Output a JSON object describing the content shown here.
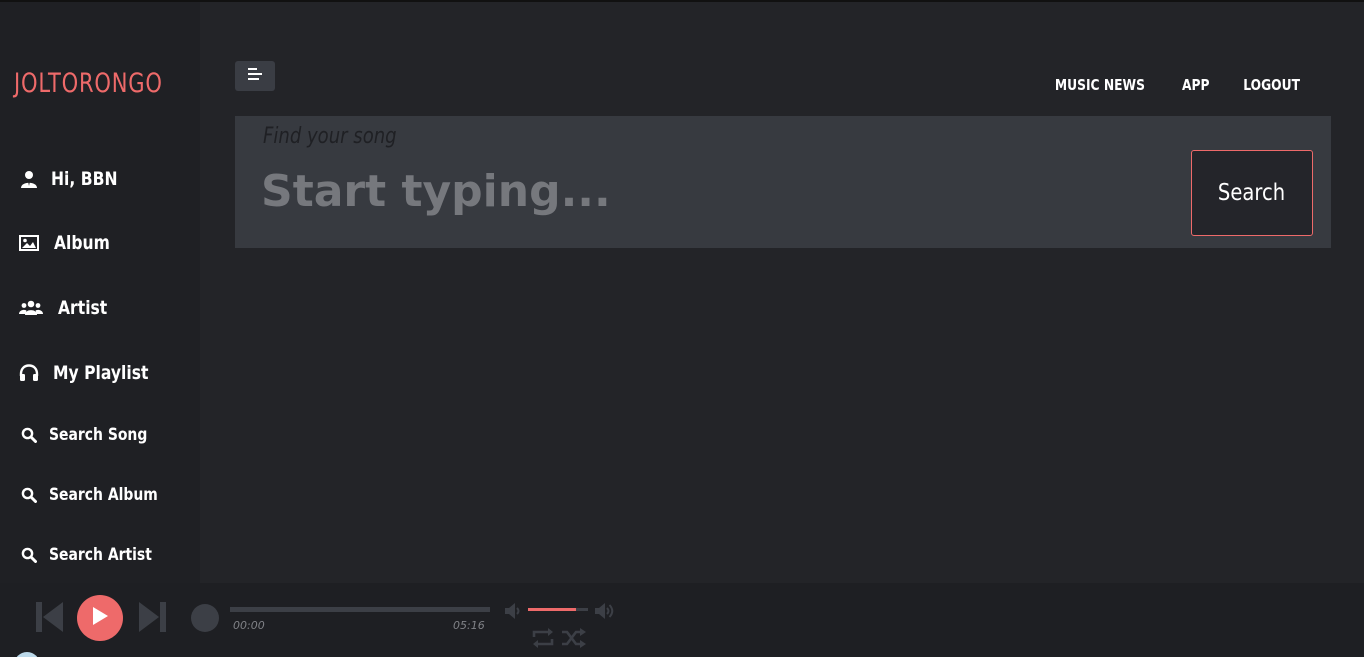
{
  "brand": "JOLTORONGO",
  "sidebar": {
    "items": [
      {
        "label": "Hi, BBN",
        "icon": "user-icon"
      },
      {
        "label": "Album",
        "icon": "image-icon"
      },
      {
        "label": "Artist",
        "icon": "users-icon"
      },
      {
        "label": "My Playlist",
        "icon": "headphones-icon"
      },
      {
        "label": "Search Song",
        "icon": "search-icon"
      },
      {
        "label": "Search Album",
        "icon": "search-icon"
      },
      {
        "label": "Search Artist",
        "icon": "search-icon"
      }
    ]
  },
  "header": {
    "menu_icon": "menu-icon",
    "links": [
      "MUSIC NEWS",
      "APP",
      "LOGOUT"
    ]
  },
  "search": {
    "label": "Find your song",
    "placeholder": "Start typing...",
    "value": "",
    "button": "Search"
  },
  "player": {
    "current_time": "00:00",
    "duration": "05:16",
    "progress": 0,
    "volume": 0.8,
    "icons": [
      "previous-icon",
      "play-icon",
      "next-icon",
      "volume-down-icon",
      "volume-up-icon",
      "repeat-icon",
      "shuffle-icon"
    ]
  },
  "colors": {
    "accent": "#ee6a6a",
    "background": "#232428",
    "sidebar": "#1f2024",
    "panel": "#373a40"
  }
}
